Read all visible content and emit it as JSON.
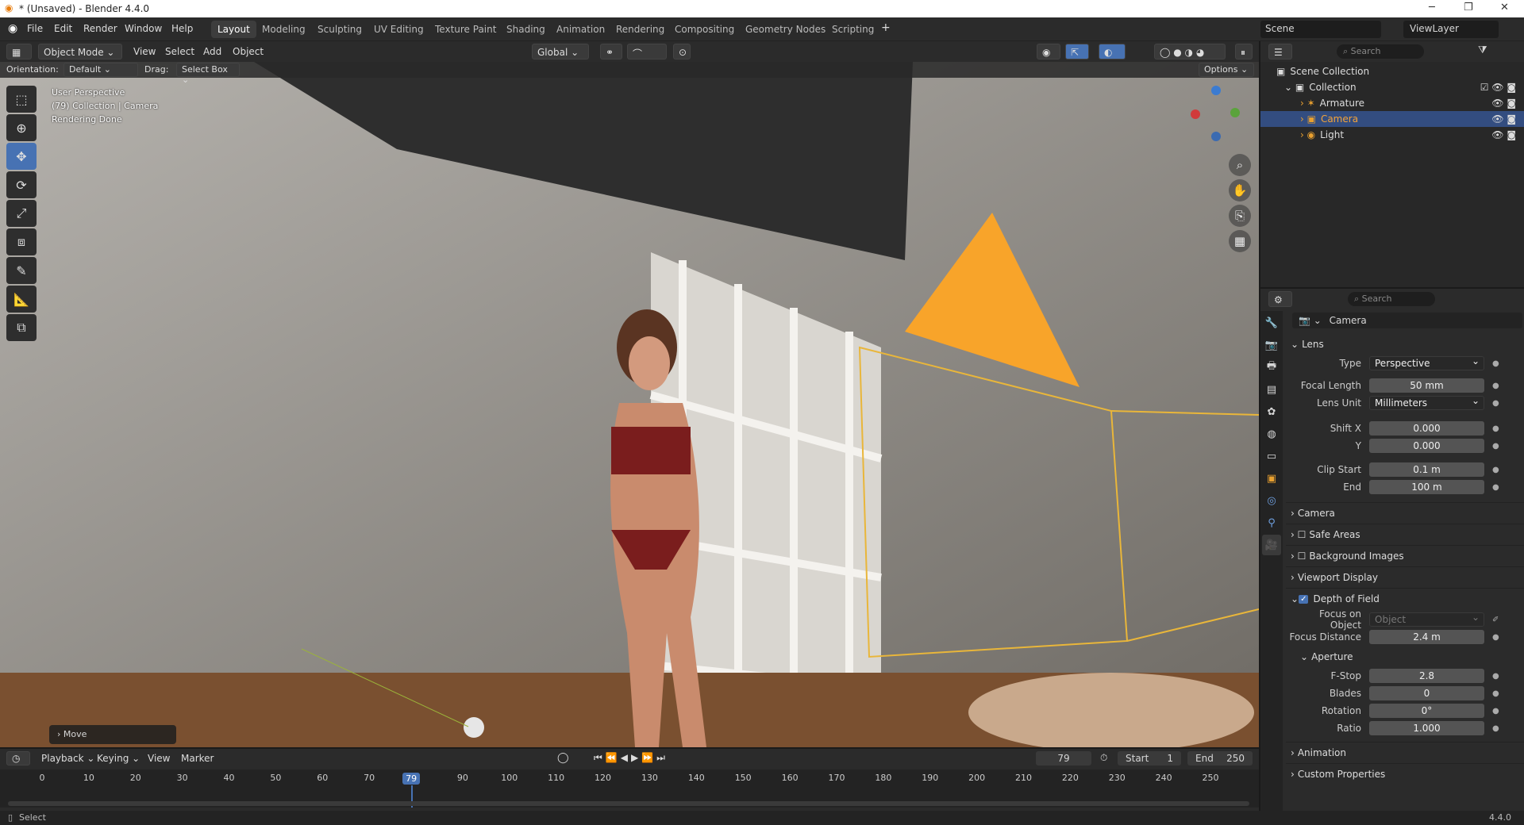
{
  "window": {
    "title": "* (Unsaved) - Blender 4.4.0",
    "controls": [
      "─",
      "❐",
      "✕"
    ]
  },
  "menu": [
    "File",
    "Edit",
    "Render",
    "Window",
    "Help"
  ],
  "workspaces": [
    "Layout",
    "Modeling",
    "Sculpting",
    "UV Editing",
    "Texture Paint",
    "Shading",
    "Animation",
    "Rendering",
    "Compositing",
    "Geometry Nodes",
    "Scripting"
  ],
  "active_workspace": "Layout",
  "scene": {
    "label": "Scene",
    "viewlayer": "ViewLayer"
  },
  "viewport_header": {
    "mode": "Object Mode",
    "menus": [
      "View",
      "Select",
      "Add",
      "Object"
    ],
    "transform": "Global",
    "options": "Options",
    "orientation_label": "Orientation:",
    "orientation": "Default",
    "drag_label": "Drag:",
    "drag": "Select Box"
  },
  "viewport_overlay": {
    "line1": "User Perspective",
    "line2": "(79) Collection | Camera",
    "line3": "Rendering Done"
  },
  "last_op": "Move",
  "tools": [
    "select-box",
    "cursor",
    "move",
    "rotate",
    "scale",
    "transform",
    "annotate",
    "measure",
    "add-cube"
  ],
  "outliner": {
    "search": "Search",
    "root": "Scene Collection",
    "collection": "Collection",
    "items": [
      "Armature",
      "Camera",
      "Light"
    ],
    "selected": "Camera"
  },
  "properties": {
    "search": "Search",
    "object": "Camera",
    "lens": {
      "header": "Lens",
      "type_label": "Type",
      "type": "Perspective",
      "focal_label": "Focal Length",
      "focal": "50 mm",
      "unit_label": "Lens Unit",
      "unit": "Millimeters",
      "shiftx_label": "Shift X",
      "shiftx": "0.000",
      "shifty_label": "Y",
      "shifty": "0.000",
      "clipstart_label": "Clip Start",
      "clipstart": "0.1 m",
      "clipend_label": "End",
      "clipend": "100 m"
    },
    "panels": [
      "Camera",
      "Safe Areas",
      "Background Images",
      "Viewport Display"
    ],
    "dof": {
      "header": "Depth of Field",
      "focus_obj_label": "Focus on Object",
      "focus_obj_placeholder": "Object",
      "focus_dist_label": "Focus Distance",
      "focus_dist": "2.4 m",
      "aperture": "Aperture",
      "fstop_label": "F-Stop",
      "fstop": "2.8",
      "blades_label": "Blades",
      "blades": "0",
      "rotation_label": "Rotation",
      "rotation": "0°",
      "ratio_label": "Ratio",
      "ratio": "1.000"
    },
    "bottom_panels": [
      "Animation",
      "Custom Properties"
    ]
  },
  "timeline": {
    "menus": [
      "Playback",
      "Keying",
      "View",
      "Marker"
    ],
    "current": "79",
    "start_label": "Start",
    "start": "1",
    "end_label": "End",
    "end": "250",
    "ticks": [
      "0",
      "10",
      "20",
      "30",
      "40",
      "50",
      "60",
      "70",
      "79",
      "90",
      "100",
      "110",
      "120",
      "130",
      "140",
      "150",
      "160",
      "170",
      "180",
      "190",
      "200",
      "210",
      "220",
      "230",
      "240",
      "250"
    ]
  },
  "status": {
    "left": "Select",
    "version": "4.4.0"
  }
}
